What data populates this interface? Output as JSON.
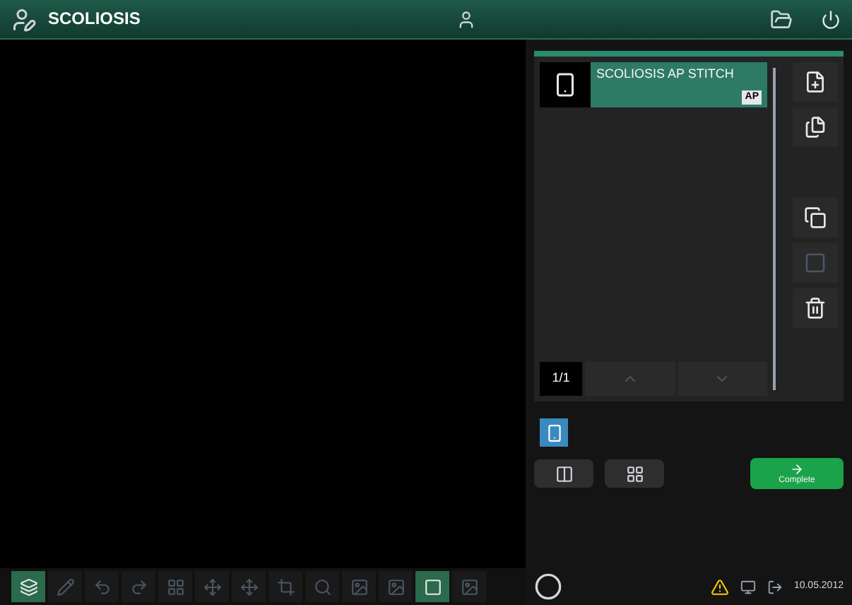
{
  "header": {
    "title": "SCOLIOSIS"
  },
  "series_list": {
    "items": [
      {
        "title": "SCOLIOSIS AP STITCH",
        "tag": "AP",
        "selected": true
      }
    ],
    "page": "1/1"
  },
  "complete_button": {
    "label": "Complete"
  },
  "toolbar": {
    "tools": [
      {
        "selected": true
      },
      {
        "selected": false
      },
      {
        "selected": false
      },
      {
        "selected": false
      },
      {
        "selected": false
      },
      {
        "selected": false
      },
      {
        "selected": false
      },
      {
        "selected": false
      },
      {
        "selected": false
      },
      {
        "selected": false
      },
      {
        "selected": false
      },
      {
        "selected": true
      },
      {
        "selected": false
      }
    ]
  },
  "status": {
    "date": "10.05.2012"
  }
}
